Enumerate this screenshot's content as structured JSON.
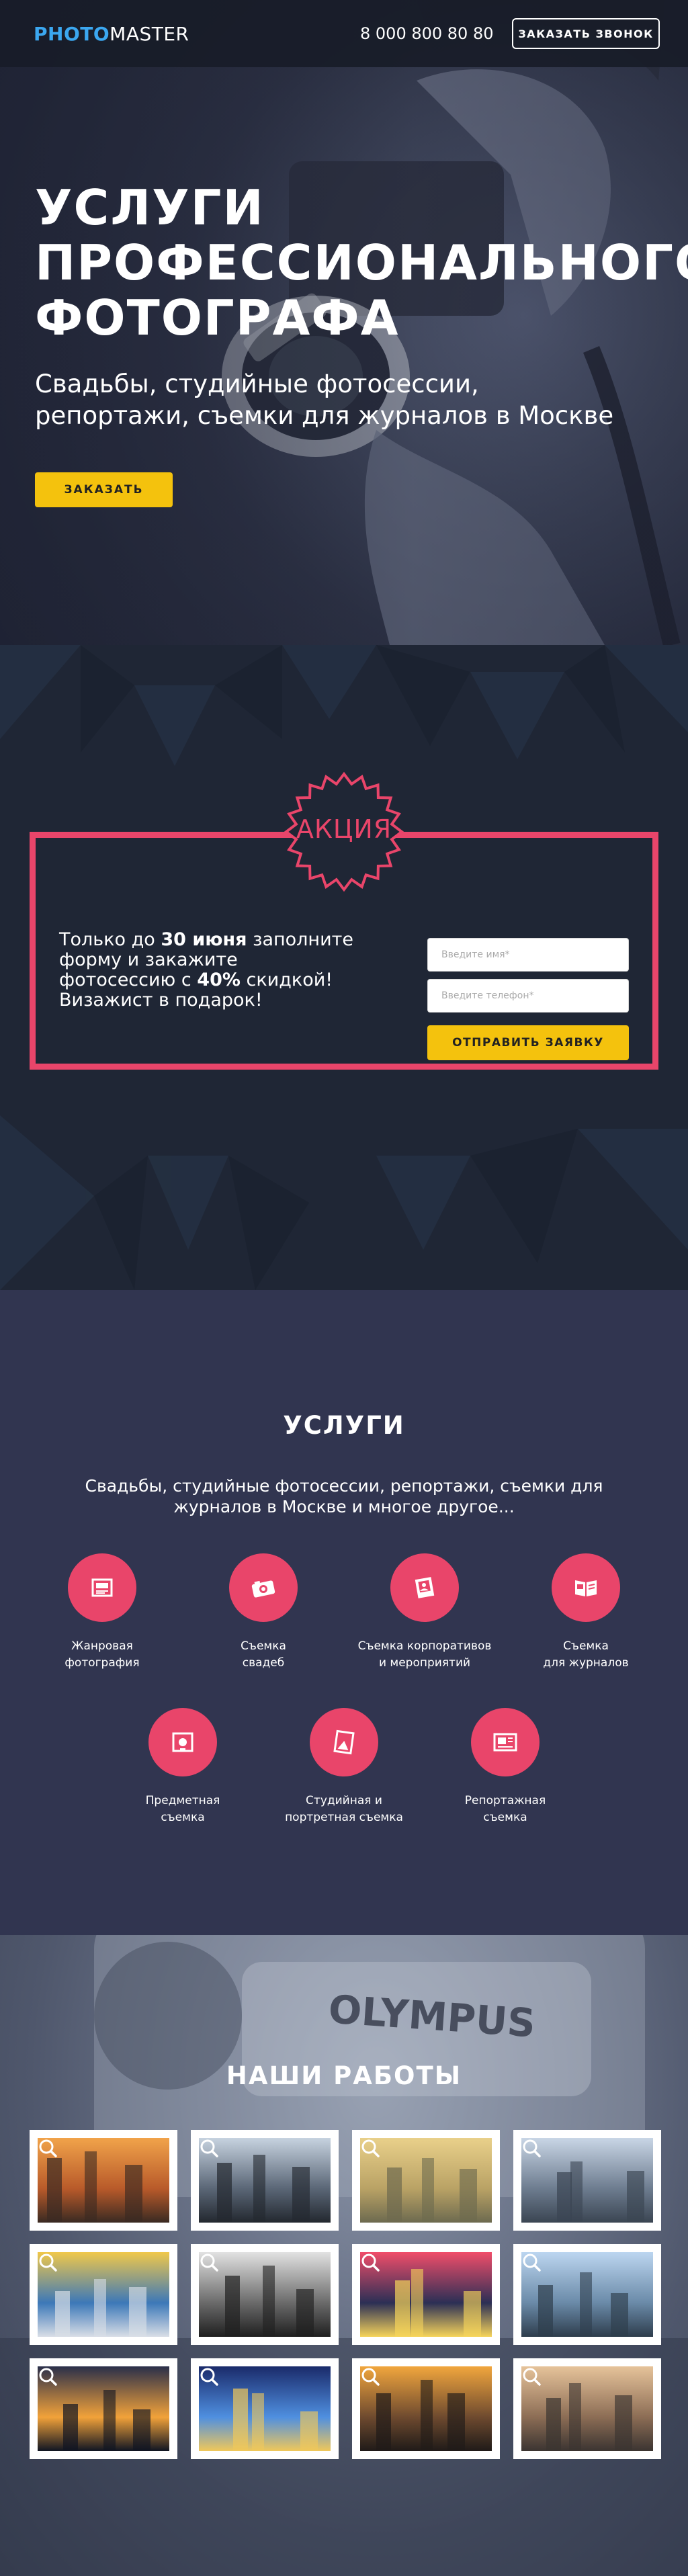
{
  "header": {
    "logo_accent": "PHOTO",
    "logo_rest": "MASTER",
    "phone": "8 000 800 80 80",
    "callback_label": "ЗАКАЗАТЬ ЗВОНОК"
  },
  "hero": {
    "title_lines": [
      "УСЛУГИ",
      "ПРОФЕССИОНАЛЬНОГО",
      "ФОТОГРАФА"
    ],
    "subtitle": "Свадьбы, студийные фотосессии, репортажи, съемки для журналов в Москве",
    "cta_label": "ЗАКАЗАТЬ"
  },
  "promo": {
    "badge": "АКЦИЯ",
    "text_1": "Только до ",
    "date": "30 июня",
    "text_2": " заполните форму и закажите фотосессию с ",
    "discount": "40%",
    "text_3": " скидкой! Визажист в подарок!",
    "name_placeholder": "Введите имя*",
    "phone_placeholder": "Введите телефон*",
    "submit_label": "ОТПРАВИТЬ ЗАЯВКУ",
    "accent_color": "#e9456a"
  },
  "services": {
    "title": "УСЛУГИ",
    "subtitle": "Свадьбы, студийные фотосессии, репортажи, съемки для журналов в Москве и многое другое...",
    "items": [
      {
        "label": "Жанровая\nфотография",
        "icon": "image-icon"
      },
      {
        "label": "Съемка\nсвадеб",
        "icon": "camera-icon"
      },
      {
        "label": "Съемка корпоративов\nи мероприятий",
        "icon": "portrait-icon"
      },
      {
        "label": "Съемка\nдля журналов",
        "icon": "magazine-icon"
      },
      {
        "label": "Предметная\nсъемка",
        "icon": "product-icon"
      },
      {
        "label": "Студийная и\nпортретная съемка",
        "icon": "frame-icon"
      },
      {
        "label": "Репортажная\nсъемка",
        "icon": "newspaper-icon"
      }
    ]
  },
  "works": {
    "title": "НАШИ РАБОТЫ",
    "photos": [
      {
        "subject": "city-rooftops-sunset-thumbnail"
      },
      {
        "subject": "skyscrapers-looking-up-thumbnail"
      },
      {
        "subject": "city-haze-panorama-thumbnail"
      },
      {
        "subject": "city-skyline-highway-thumbnail"
      },
      {
        "subject": "high-speed-train-thumbnail"
      },
      {
        "subject": "black-white-avenue-thumbnail"
      },
      {
        "subject": "times-square-night-thumbnail"
      },
      {
        "subject": "skyline-with-lake-thumbnail"
      },
      {
        "subject": "waterfront-night-thumbnail"
      },
      {
        "subject": "city-night-lights-thumbnail"
      },
      {
        "subject": "sunset-street-traffic-thumbnail"
      },
      {
        "subject": "bridge-city-sunset-thumbnail"
      }
    ]
  }
}
